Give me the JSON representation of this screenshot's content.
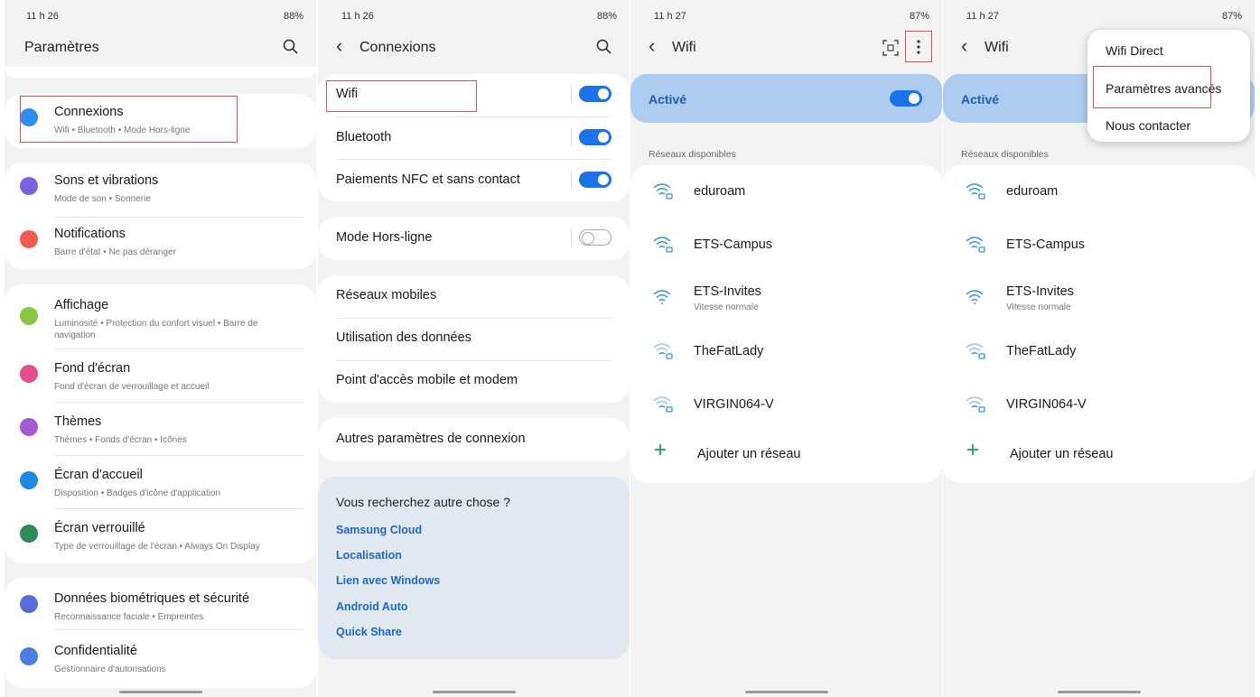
{
  "status": {
    "p1": {
      "time": "11 h 26",
      "right": "88%"
    },
    "p2": {
      "time": "11 h 26",
      "right": "88%"
    },
    "p3": {
      "time": "11 h 27",
      "right": "87%"
    },
    "p4": {
      "time": "11 h 27",
      "right": "87%"
    }
  },
  "settings": {
    "title": "Paramètres",
    "items": [
      {
        "title": "Connexions",
        "sub": "Wifi  •  Bluetooth  •  Mode Hors-ligne",
        "color": "#2f8ff0"
      },
      {
        "title": "Sons et vibrations",
        "sub": "Mode de son  •  Sonnerie",
        "color": "#7b61e0"
      },
      {
        "title": "Notifications",
        "sub": "Barre d'état  •  Ne pas déranger",
        "color": "#ef5b4c"
      },
      {
        "title": "Affichage",
        "sub": "Luminosité  •  Protection du confort visuel  •  Barre de navigation",
        "color": "#8cc63e"
      },
      {
        "title": "Fond d'écran",
        "sub": "Fond d'écran de verrouillage et accueil",
        "color": "#e34f8a"
      },
      {
        "title": "Thèmes",
        "sub": "Thèmes  •  Fonds d'écran  •  Icônes",
        "color": "#a45ad4"
      },
      {
        "title": "Écran d'accueil",
        "sub": "Disposition  •  Badges d'icône d'application",
        "color": "#1e88e5"
      },
      {
        "title": "Écran verrouillé",
        "sub": "Type de verrouillage de l'écran  •  Always On Display",
        "color": "#2e8b57"
      },
      {
        "title": "Données biométriques et sécurité",
        "sub": "Reconnaissance faciale  •  Empreintes",
        "color": "#5c6bd8"
      },
      {
        "title": "Confidentialité",
        "sub": "Gestionnaire d'autorisations",
        "color": "#4a7fe0"
      }
    ]
  },
  "connexions": {
    "title": "Connexions",
    "rows": [
      {
        "label": "Wifi",
        "toggle": "on"
      },
      {
        "label": "Bluetooth",
        "toggle": "on"
      },
      {
        "label": "Paiements NFC et sans contact",
        "toggle": "on"
      },
      {
        "label": "Mode Hors-ligne",
        "toggle": "off"
      },
      {
        "label": "Réseaux mobiles"
      },
      {
        "label": "Utilisation des données"
      },
      {
        "label": "Point d'accès mobile et modem"
      },
      {
        "label": "Autres paramètres de connexion"
      }
    ],
    "lookfor": {
      "heading": "Vous recherchez autre chose ?",
      "links": [
        "Samsung Cloud",
        "Localisation",
        "Lien avec Windows",
        "Android Auto",
        "Quick Share"
      ]
    }
  },
  "wifi": {
    "title": "Wifi",
    "active_label": "Activé",
    "section_label": "Réseaux disponibles",
    "networks": [
      {
        "name": "eduroam",
        "sub": "",
        "locked": true
      },
      {
        "name": "ETS-Campus",
        "sub": "",
        "locked": true
      },
      {
        "name": "ETS-Invites",
        "sub": "Vitesse normale",
        "locked": false
      },
      {
        "name": "TheFatLady",
        "sub": "",
        "locked": true
      },
      {
        "name": "VIRGIN064-V",
        "sub": "",
        "locked": true
      }
    ],
    "add_label": "Ajouter un réseau",
    "menu": [
      "Wifi Direct",
      "Paramètres avancés",
      "Nous contacter"
    ]
  },
  "colors": {
    "accent": "#1a73e8",
    "link": "#1c69c7",
    "active_bg": "#aecbf2",
    "highlight": "#d9534f"
  }
}
